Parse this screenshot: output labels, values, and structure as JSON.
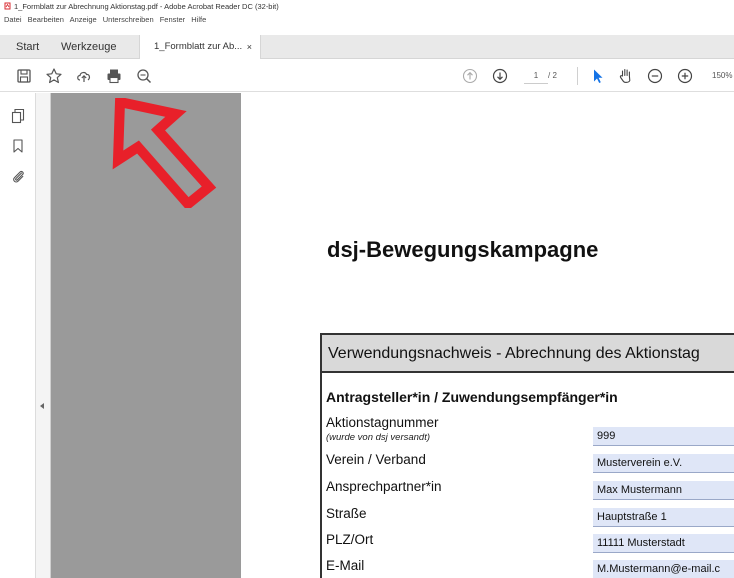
{
  "window": {
    "title": "1_Formblatt zur Abrechnung Aktionstag.pdf - Adobe Acrobat Reader DC (32-bit)"
  },
  "menu": [
    "Datei",
    "Bearbeiten",
    "Anzeige",
    "Unterschreiben",
    "Fenster",
    "Hilfe"
  ],
  "tabs": {
    "start": "Start",
    "tools": "Werkzeuge",
    "document": "1_Formblatt zur Ab...",
    "close": "×"
  },
  "toolbar": {
    "page_current": "1",
    "page_total": "/ 2",
    "zoom": "150%",
    "icons": [
      "save-icon",
      "bookmark-star-icon",
      "upload-cloud-icon",
      "print-icon",
      "zoom-search-icon",
      "page-up-icon",
      "page-down-icon",
      "select-cursor-icon",
      "hand-tool-icon",
      "zoom-out-icon",
      "zoom-in-icon"
    ]
  },
  "sidebar": {
    "icons": [
      "pages-icon",
      "bookmark-icon",
      "attachment-icon"
    ]
  },
  "document": {
    "heading": "dsj-Bewegungskampagne",
    "form_title": "Verwendungsnachweis - Abrechnung des Aktionstag",
    "section_title": "Antragsteller*in / Zuwendungsempfänger*in",
    "rows": [
      {
        "label": "Aktionstagnummer",
        "sublabel": "(wurde von dsj versandt)",
        "value": "999"
      },
      {
        "label": "Verein / Verband",
        "value": "Musterverein e.V."
      },
      {
        "label": "Ansprechpartner*in",
        "value": "Max Mustermann"
      },
      {
        "label": "Straße",
        "value": "Hauptstraße 1"
      },
      {
        "label": "PLZ/Ort",
        "value": "11111 Musterstadt"
      },
      {
        "label": "E-Mail",
        "value": "M.Mustermann@e-mail.c"
      }
    ]
  },
  "colors": {
    "annotation_arrow": "#e8202a",
    "field_fill": "#dfe6f7",
    "accent": "#1473e6"
  }
}
